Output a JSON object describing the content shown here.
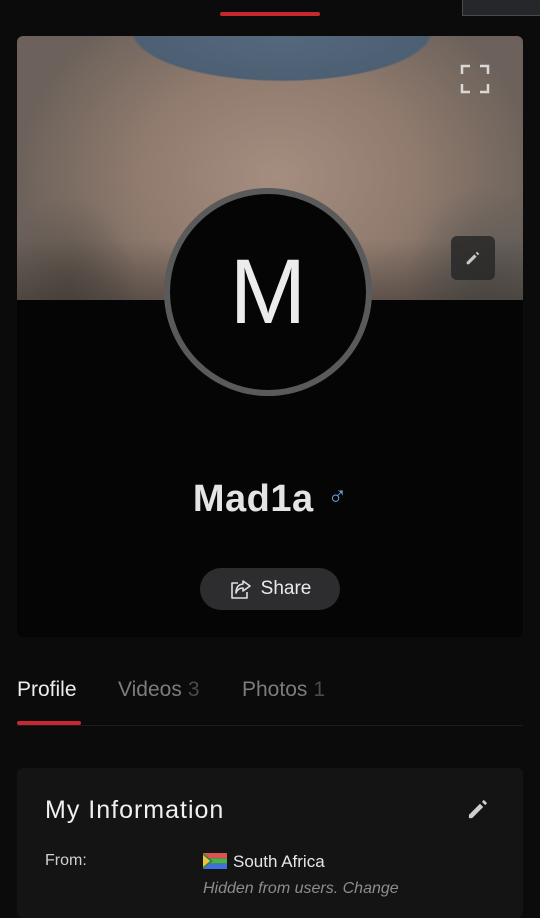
{
  "colors": {
    "accent": "#c8282d",
    "gender": "#6ea8e6",
    "background": "#0b0b0c"
  },
  "profile": {
    "avatar_letter": "M",
    "username": "Mad1a",
    "gender_symbol": "♂",
    "share_label": "Share"
  },
  "tabs": [
    {
      "label": "Profile",
      "count": "",
      "active": true
    },
    {
      "label": "Videos",
      "count": "3",
      "active": false
    },
    {
      "label": "Photos",
      "count": "1",
      "active": false
    }
  ],
  "info": {
    "title": "My Information",
    "from_label": "From:",
    "from_value": "South Africa",
    "from_note": "Hidden from users. Change"
  },
  "icons": {
    "expand": "expand-icon",
    "edit_cover": "pencil-icon",
    "share": "share-icon",
    "edit_info": "pencil-icon",
    "flag": "south-africa-flag-icon"
  }
}
